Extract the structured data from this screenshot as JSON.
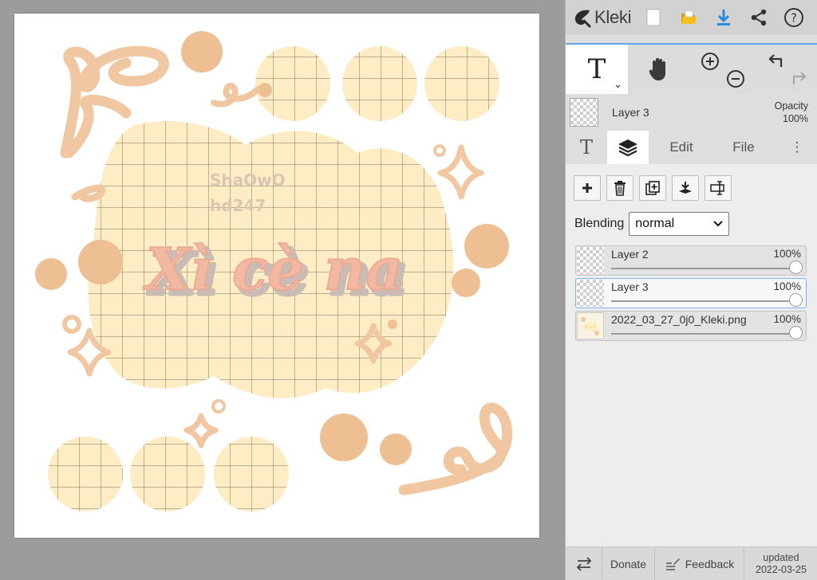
{
  "app": {
    "name": "Kleki"
  },
  "toolbar": {
    "icons": [
      "kleki-logo-icon",
      "new-image-icon",
      "open-folder-icon",
      "download-icon",
      "share-icon",
      "help-icon"
    ]
  },
  "tools": {
    "text_glyph": "T",
    "chevron": "⌄",
    "icons": [
      "text-tool-icon",
      "hand-tool-icon",
      "zoom-in-icon",
      "zoom-out-icon",
      "undo-icon",
      "redo-icon"
    ]
  },
  "current_layer": {
    "name": "Layer 3",
    "opacity_label": "Opacity",
    "opacity_value": "100%"
  },
  "tabs": {
    "brush_glyph": "T",
    "edit": "Edit",
    "file": "File",
    "more": "⋮"
  },
  "layer_panel": {
    "action_icons": [
      "add-layer-icon",
      "delete-layer-icon",
      "duplicate-layer-icon",
      "merge-down-icon",
      "rename-layer-icon"
    ],
    "blending_label": "Blending",
    "blending_value": "normal",
    "layers": [
      {
        "name": "Layer 2",
        "opacity": "100%",
        "opacity_value": 1.0,
        "active": false
      },
      {
        "name": "Layer 3",
        "opacity": "100%",
        "opacity_value": 1.0,
        "active": true
      },
      {
        "name": "2022_03_27_0j0_Kleki.png",
        "opacity": "100%",
        "opacity_value": 1.0,
        "active": false
      }
    ]
  },
  "bottombar": {
    "donate": "Donate",
    "feedback": "Feedback",
    "updated_label": "updated",
    "updated_date": "2022-03-25"
  },
  "artwork": {
    "watermark_line1": "ShaOwO",
    "watermark_line2": "hd247",
    "title": "Xì cè na",
    "colors": {
      "panel": "#fdecc4",
      "grid": "#6f6a55",
      "doodle": "#f0c7a0",
      "dot": "#eebf93",
      "title_fill": "#f1b9a2",
      "title_shadow": "#c8bcb4",
      "watermark": "#d9c7b4"
    }
  },
  "colors": {
    "accent": "#2b8ae0",
    "folder": "#f3bf1b",
    "background": "#9c9c9c"
  }
}
